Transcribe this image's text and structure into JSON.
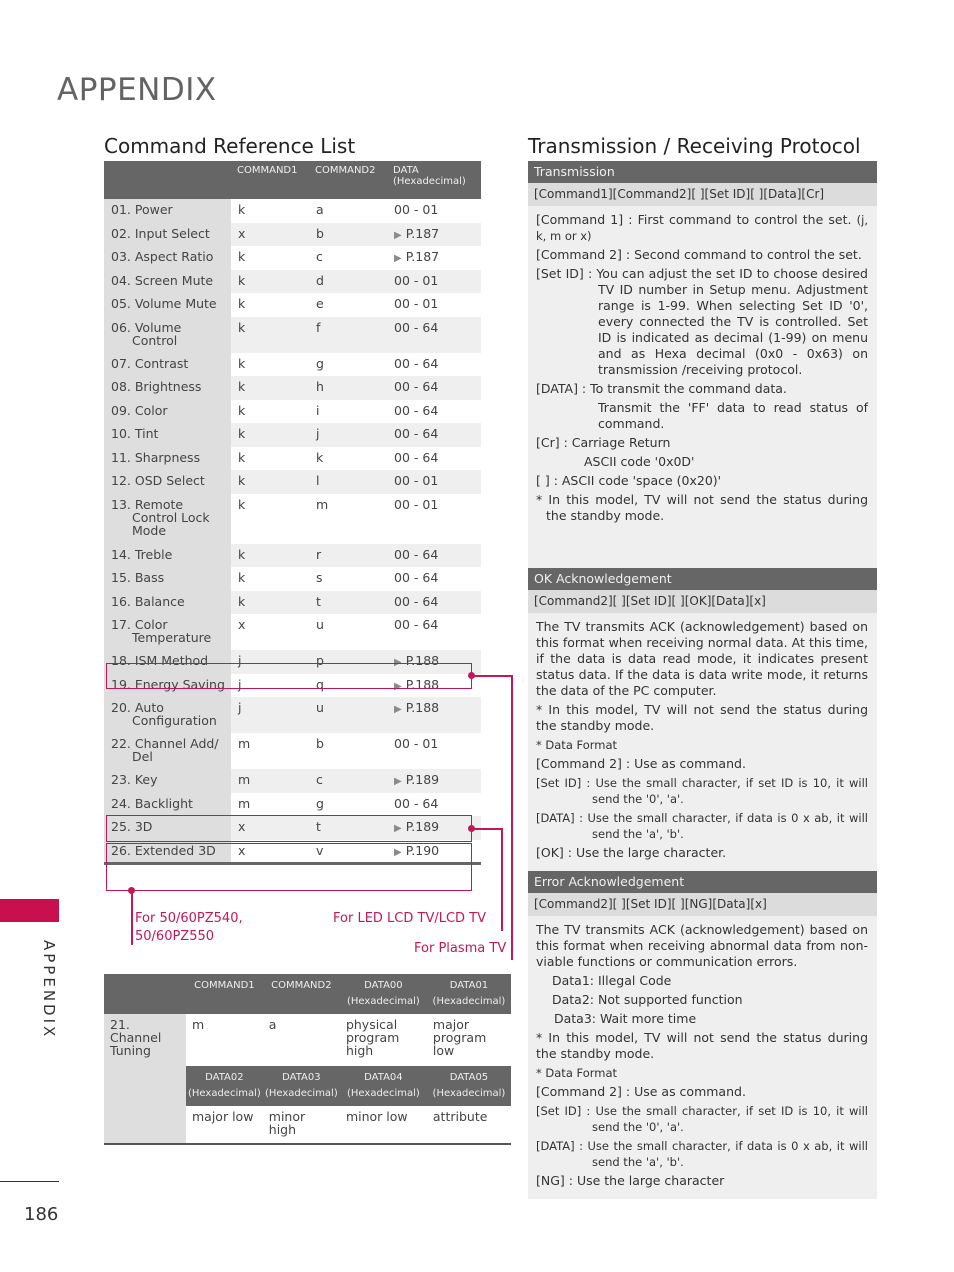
{
  "page": {
    "title": "APPENDIX",
    "side_label": "APPENDIX",
    "page_number": "186",
    "accent_color": "#c8104f"
  },
  "command_list": {
    "title": "Command Reference List",
    "headers": {
      "name": "",
      "command1": "COMMAND1",
      "command2": "COMMAND2",
      "data": "DATA",
      "data_sub": "(Hexadecimal)"
    },
    "rows": [
      {
        "name": "01. Power",
        "cont": "",
        "c1": "k",
        "c2": "a",
        "data": "00 - 01",
        "arrow": false
      },
      {
        "name": "02. Input Select",
        "cont": "",
        "c1": "x",
        "c2": "b",
        "data": "P.187",
        "arrow": true
      },
      {
        "name": "03. Aspect Ratio",
        "cont": "",
        "c1": "k",
        "c2": "c",
        "data": "P.187",
        "arrow": true
      },
      {
        "name": "04. Screen Mute",
        "cont": "",
        "c1": "k",
        "c2": "d",
        "data": "00 - 01",
        "arrow": false
      },
      {
        "name": "05. Volume Mute",
        "cont": "",
        "c1": "k",
        "c2": "e",
        "data": "00 - 01",
        "arrow": false
      },
      {
        "name": "06. Volume",
        "cont": "Control",
        "c1": "k",
        "c2": "f",
        "data": "00 - 64",
        "arrow": false
      },
      {
        "name": "07. Contrast",
        "cont": "",
        "c1": "k",
        "c2": "g",
        "data": "00 - 64",
        "arrow": false
      },
      {
        "name": "08. Brightness",
        "cont": "",
        "c1": "k",
        "c2": "h",
        "data": "00 - 64",
        "arrow": false
      },
      {
        "name": "09. Color",
        "cont": "",
        "c1": "k",
        "c2": "i",
        "data": "00 - 64",
        "arrow": false
      },
      {
        "name": "10. Tint",
        "cont": "",
        "c1": "k",
        "c2": "j",
        "data": "00 - 64",
        "arrow": false
      },
      {
        "name": "11. Sharpness",
        "cont": "",
        "c1": "k",
        "c2": "k",
        "data": "00 - 64",
        "arrow": false
      },
      {
        "name": "12. OSD Select",
        "cont": "",
        "c1": "k",
        "c2": "l",
        "data": "00 - 01",
        "arrow": false
      },
      {
        "name": "13. Remote",
        "cont": "Control Lock Mode",
        "c1": "k",
        "c2": "m",
        "data": "00 - 01",
        "arrow": false
      },
      {
        "name": "14. Treble",
        "cont": "",
        "c1": "k",
        "c2": "r",
        "data": "00 - 64",
        "arrow": false
      },
      {
        "name": "15. Bass",
        "cont": "",
        "c1": "k",
        "c2": "s",
        "data": "00 - 64",
        "arrow": false
      },
      {
        "name": "16. Balance",
        "cont": "",
        "c1": "k",
        "c2": "t",
        "data": "00 - 64",
        "arrow": false
      },
      {
        "name": "17. Color",
        "cont": "Temperature",
        "c1": "x",
        "c2": "u",
        "data": "00 - 64",
        "arrow": false
      },
      {
        "name": "18. ISM Method",
        "cont": "",
        "c1": "j",
        "c2": "p",
        "data": "P.188",
        "arrow": true
      },
      {
        "name": "19. Energy Saving",
        "cont": "",
        "c1": "j",
        "c2": "q",
        "data": "P.188",
        "arrow": true
      },
      {
        "name": "20. Auto",
        "cont": "Configuration",
        "c1": "j",
        "c2": "u",
        "data": "P.188",
        "arrow": true
      },
      {
        "name": "22. Channel Add/",
        "cont": "Del",
        "c1": "m",
        "c2": "b",
        "data": "00 - 01",
        "arrow": false
      },
      {
        "name": "23. Key",
        "cont": "",
        "c1": "m",
        "c2": "c",
        "data": "P.189",
        "arrow": true
      },
      {
        "name": "24. Backlight",
        "cont": "",
        "c1": "m",
        "c2": "g",
        "data": "00 - 64",
        "arrow": false
      },
      {
        "name": "25. 3D",
        "cont": "",
        "c1": "x",
        "c2": "t",
        "data": "P.189",
        "arrow": true
      },
      {
        "name": "26. Extended 3D",
        "cont": "",
        "c1": "x",
        "c2": "v",
        "data": "P.190",
        "arrow": true
      }
    ],
    "notes": {
      "models": "For 50/60PZ540,\n50/60PZ550",
      "led_lcd": "For LED LCD TV/LCD TV",
      "plasma": "For Plasma TV"
    }
  },
  "channel_tuning": {
    "name": "21.\nChannel\nTuning",
    "headers1": [
      "COMMAND1",
      "COMMAND2",
      "DATA00",
      "DATA01"
    ],
    "headers2": [
      "DATA02",
      "DATA03",
      "DATA04",
      "DATA05"
    ],
    "hex_sub": "(Hexadecimal)",
    "row1": [
      "m",
      "a",
      "physical program high",
      "major program low"
    ],
    "row2": [
      "major low",
      "minor high",
      "minor low",
      "attribute"
    ]
  },
  "protocol": {
    "title": "Transmission / Receiving Protocol",
    "transmission": {
      "header": "Transmission",
      "format": "[Command1][Command2][  ][Set ID][  ][Data][Cr]",
      "cmd1": "[Command 1] : First command to control the set.",
      "cmd1_small": "(j, k, m or x)",
      "cmd2": "[Command 2] : Second command to control the set.",
      "setid": "[Set ID] : You can adjust the set ID to choose desired TV ID number in Setup menu. Adjustment range is 1-99. When selecting Set ID '0', every connected the TV is controlled. Set ID is indicated as decimal (1-99) on menu and as Hexa decimal (0x0 - 0x63) on transmission /receiving protocol.",
      "data": "[DATA] : To transmit the command data.",
      "data2": "Transmit the 'FF' data to read status of command.",
      "cr": "[Cr] : Carriage Return",
      "cr2": "ASCII code '0x0D'",
      "space": "[   ] : ASCII code 'space (0x20)'",
      "note": "* In this model, TV will not send the status during the standby mode."
    },
    "ok_ack": {
      "header": "OK Acknowledgement",
      "format": "[Command2][  ][Set ID][  ][OK][Data][x]",
      "desc": "The TV transmits ACK (acknowledgement) based on this format when receiving normal data. At this time, if the data is data read mode, it indicates present status data. If the data is data write mode, it returns the data of the PC computer.",
      "note": "* In this model, TV will not send the status during the standby mode.",
      "format_label": "* Data Format",
      "cmd2": "[Command 2] : Use as command.",
      "setid": "[Set ID] : Use the small character, if set ID is 10, it will send the '0', 'a'.",
      "data": "[DATA] : Use the small character, if data is 0 x ab, it will send the 'a', 'b'.",
      "ok": "[OK] : Use the large character."
    },
    "err_ack": {
      "header": "Error Acknowledgement",
      "format": "[Command2][  ][Set ID][  ][NG][Data][x]",
      "desc": "The TV transmits ACK (acknowledgement) based on this format when receiving abnormal data from non-viable functions or communication errors.",
      "d1": "Data1: Illegal Code",
      "d2": "Data2: Not supported function",
      "d3": "Data3: Wait more time",
      "note": "* In this model, TV will not send the status during the standby mode.",
      "format_label": "* Data Format",
      "cmd2": "[Command 2] : Use as command.",
      "setid": "[Set ID] : Use the small character, if set ID is 10, it will send the '0', 'a'.",
      "data": "[DATA] : Use the small character, if data is 0 x ab, it will send the 'a', 'b'.",
      "ng": "[NG] : Use the large character"
    }
  }
}
